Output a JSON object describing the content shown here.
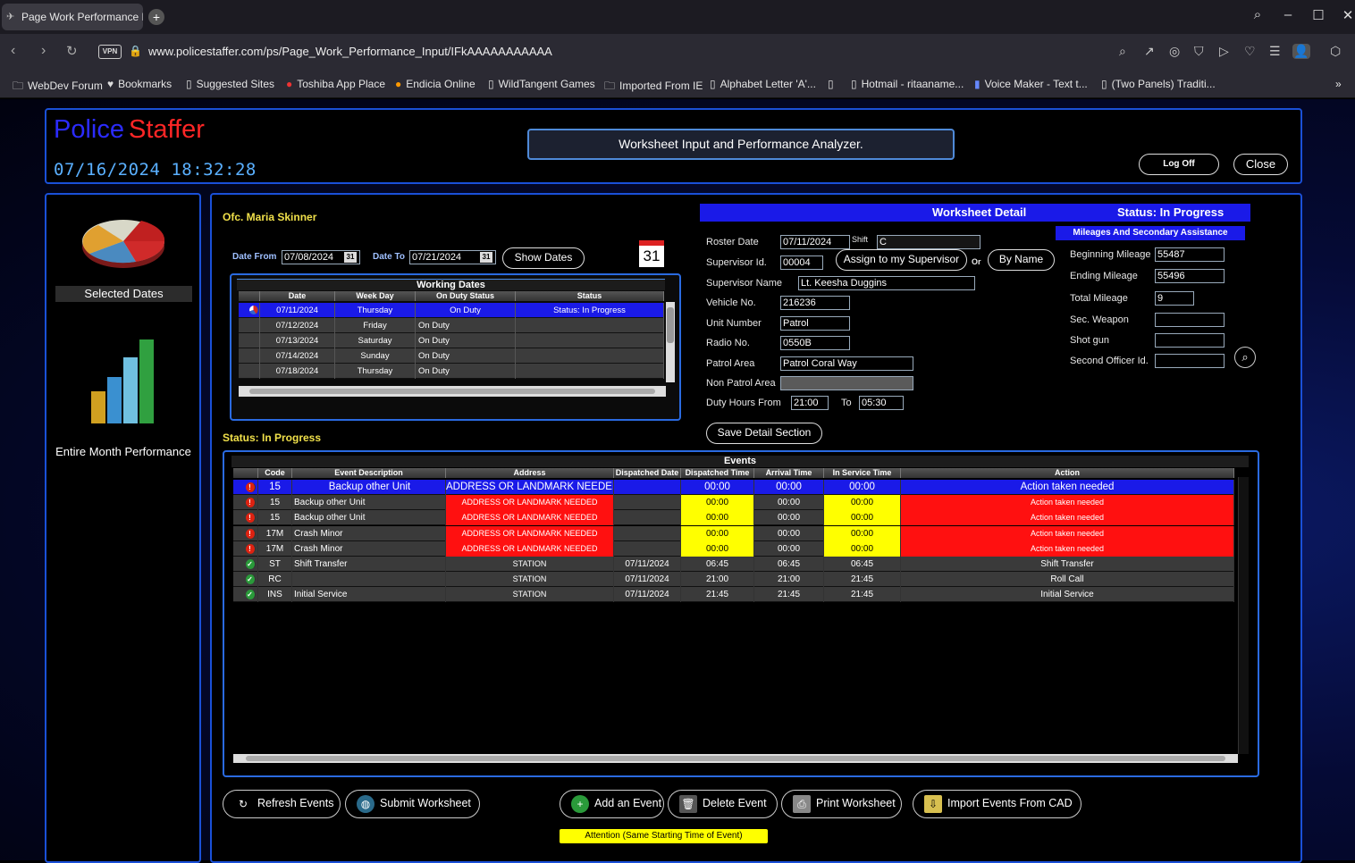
{
  "browser": {
    "tab_title": "Page Work Performance R",
    "url": "www.policestaffer.com/ps/Page_Work_Performance_Input/IFkAAAAAAAAAAA",
    "vpn_label": "VPN",
    "bookmarks": [
      "WebDev Forum",
      "Bookmarks",
      "Suggested Sites",
      "Toshiba App Place",
      "Endicia Online",
      "WildTangent Games",
      "Imported From IE",
      "Alphabet Letter 'A'...",
      "",
      "Hotmail - ritaaname...",
      "Voice Maker - Text t...",
      "(Two Panels) Traditi..."
    ]
  },
  "header": {
    "brand_part1": "Police",
    "brand_part2": "Staffer",
    "datetime": "07/16/2024 18:32:28",
    "title": "Worksheet Input and Performance Analyzer.",
    "log_off": "Log Off",
    "close": "Close"
  },
  "sidebar": {
    "selected_dates": "Selected Dates",
    "entire_month": "Entire Month Performance"
  },
  "officer": "Ofc. Maria Skinner",
  "date_filter": {
    "from_label": "Date From",
    "from_value": "07/08/2024",
    "to_label": "Date To",
    "to_value": "07/21/2024",
    "cal_icon": "31",
    "show_dates": "Show Dates",
    "big_cal": "31"
  },
  "working_dates": {
    "title": "Working Dates",
    "headers": [
      "Date",
      "Week Day",
      "On Duty Status",
      "Status"
    ],
    "rows": [
      {
        "date": "07/11/2024",
        "weekday": "Thursday",
        "duty": "On Duty",
        "status": "Status:  In Progress",
        "selected": true
      },
      {
        "date": "07/12/2024",
        "weekday": "Friday",
        "duty": "On Duty",
        "status": ""
      },
      {
        "date": "07/13/2024",
        "weekday": "Saturday",
        "duty": "On Duty",
        "status": ""
      },
      {
        "date": "07/14/2024",
        "weekday": "Sunday",
        "duty": "On Duty",
        "status": ""
      },
      {
        "date": "07/18/2024",
        "weekday": "Thursday",
        "duty": "On Duty",
        "status": ""
      }
    ]
  },
  "status_line": "Status:  In Progress",
  "detail": {
    "title": "Worksheet Detail",
    "status": "Status:  In Progress",
    "roster_date_label": "Roster Date",
    "roster_date": "07/11/2024",
    "shift_label": "Shift",
    "shift": "C",
    "supervisor_id_label": "Supervisor Id.",
    "supervisor_id": "00004",
    "assign_button": "Assign to my Supervisor",
    "or_label": "Or",
    "by_name_button": "By Name",
    "supervisor_name_label": "Supervisor Name",
    "supervisor_name": "Lt. Keesha Duggins",
    "vehicle_label": "Vehicle No.",
    "vehicle": "216236",
    "unit_label": "Unit Number",
    "unit": "Patrol",
    "radio_label": "Radio No.",
    "radio": "0550B",
    "patrol_area_label": "Patrol Area",
    "patrol_area": "Patrol Coral Way",
    "non_patrol_label": "Non Patrol Area",
    "non_patrol": "",
    "duty_from_label": "Duty Hours From",
    "duty_from": "21:00",
    "to_label": "To",
    "duty_to": "05:30",
    "save_button": "Save Detail Section"
  },
  "mileage": {
    "title": "Mileages And Secondary Assistance",
    "beginning_label": "Beginning Mileage",
    "beginning": "55487",
    "ending_label": "Ending Mileage",
    "ending": "55496",
    "total_label": "Total Mileage",
    "total": "9",
    "weapon_label": "Sec. Weapon",
    "weapon": "",
    "shotgun_label": "Shot gun",
    "shotgun": "",
    "second_officer_label": "Second Officer Id.",
    "second_officer": ""
  },
  "events": {
    "title": "Events",
    "headers": [
      "Code",
      "Event Description",
      "Address",
      "Dispatched Date",
      "Dispatched Time",
      "Arrival Time",
      "In Service Time",
      "Action"
    ],
    "rows": [
      {
        "icon": "alert",
        "code": "15",
        "desc": "Backup other Unit",
        "address": "ADDRESS OR LANDMARK NEEDED",
        "ddate": "",
        "dtime": "00:00",
        "arrival": "00:00",
        "inservice": "00:00",
        "action": "Action taken needed",
        "kind": "selected"
      },
      {
        "icon": "alert",
        "code": "15",
        "desc": "Backup other Unit",
        "address": "ADDRESS OR LANDMARK NEEDED",
        "ddate": "",
        "dtime": "00:00",
        "arrival": "00:00",
        "inservice": "00:00",
        "action": "Action taken needed",
        "kind": "error"
      },
      {
        "icon": "alert",
        "code": "15",
        "desc": "Backup other Unit",
        "address": "ADDRESS OR LANDMARK NEEDED",
        "ddate": "",
        "dtime": "00:00",
        "arrival": "00:00",
        "inservice": "00:00",
        "action": "Action taken needed",
        "kind": "error"
      },
      {
        "icon": "alert",
        "code": "17M",
        "desc": "Crash Minor",
        "address": "ADDRESS OR LANDMARK NEEDED",
        "ddate": "",
        "dtime": "00:00",
        "arrival": "00:00",
        "inservice": "00:00",
        "action": "Action taken needed",
        "kind": "error"
      },
      {
        "icon": "alert",
        "code": "17M",
        "desc": "Crash Minor",
        "address": "ADDRESS OR LANDMARK NEEDED",
        "ddate": "",
        "dtime": "00:00",
        "arrival": "00:00",
        "inservice": "00:00",
        "action": "Action taken needed",
        "kind": "error"
      },
      {
        "icon": "ok",
        "code": "ST",
        "desc": "Shift Transfer",
        "address": "STATION",
        "ddate": "07/11/2024",
        "dtime": "06:45",
        "arrival": "06:45",
        "inservice": "06:45",
        "action": "Shift Transfer",
        "kind": "ok"
      },
      {
        "icon": "ok",
        "code": "RC",
        "desc": "",
        "address": "STATION",
        "ddate": "07/11/2024",
        "dtime": "21:00",
        "arrival": "21:00",
        "inservice": "21:45",
        "action": "Roll Call",
        "kind": "ok"
      },
      {
        "icon": "ok",
        "code": "INS",
        "desc": "Initial Service",
        "address": "STATION",
        "ddate": "07/11/2024",
        "dtime": "21:45",
        "arrival": "21:45",
        "inservice": "21:45",
        "action": "Initial Service",
        "kind": "ok"
      }
    ]
  },
  "buttons": {
    "refresh": "Refresh Events",
    "submit": "Submit Worksheet",
    "add": "Add an Event",
    "delete": "Delete Event",
    "print": "Print Worksheet",
    "import": "Import Events From CAD"
  },
  "attention": "Attention (Same Starting Time of Event)",
  "colors": {
    "selected": "#1a1ae8",
    "error": "#ff1010",
    "warn": "#ffff00",
    "row": "#3a3a3a",
    "accent": "#1a50d8"
  }
}
